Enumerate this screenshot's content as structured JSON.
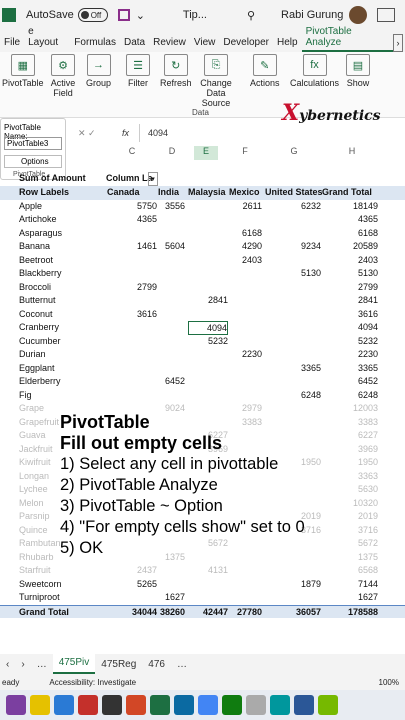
{
  "titlebar": {
    "autosave": "AutoSave",
    "toggle": "Off",
    "doc": "Tip...",
    "user": "Rabi Gurung"
  },
  "tabs": [
    "File",
    "e Layout",
    "Formulas",
    "Data",
    "Review",
    "View",
    "Developer",
    "Help",
    "PivotTable Analyze"
  ],
  "ribbon": {
    "pivottable": "PivotTable",
    "active_field": "Active Field",
    "group": "Group",
    "filter": "Filter",
    "refresh": "Refresh",
    "change_source": "Change Data Source",
    "actions": "Actions",
    "calculations": "Calculations",
    "show": "Show",
    "data_group": "Data"
  },
  "brand": "ybernetics",
  "pivot_panel": {
    "label": "PivotTable Name:",
    "name": "PivotTable3",
    "options": "Options",
    "caption": "PivotTable"
  },
  "formula_bar": {
    "value": "4094"
  },
  "columns": [
    "C",
    "D",
    "E",
    "F",
    "G",
    "H"
  ],
  "pivot": {
    "header1": [
      "Sum of Amount",
      "Column La"
    ],
    "header2": [
      "Row Labels",
      "Canada",
      "India",
      "Malaysia",
      "Mexico",
      "United States",
      "Grand Total"
    ],
    "rows": [
      [
        "Apple",
        "5750",
        "3556",
        "",
        "2611",
        "6232",
        "18149"
      ],
      [
        "Artichoke",
        "4365",
        "",
        "",
        "",
        "",
        "4365"
      ],
      [
        "Asparagus",
        "",
        "",
        "",
        "6168",
        "",
        "6168"
      ],
      [
        "Banana",
        "1461",
        "5604",
        "",
        "4290",
        "9234",
        "20589"
      ],
      [
        "Beetroot",
        "",
        "",
        "",
        "2403",
        "",
        "2403"
      ],
      [
        "Blackberry",
        "",
        "",
        "",
        "",
        "5130",
        "5130"
      ],
      [
        "Broccoli",
        "2799",
        "",
        "",
        "",
        "",
        "2799"
      ],
      [
        "Butternut",
        "",
        "",
        "2841",
        "",
        "",
        "2841"
      ],
      [
        "Coconut",
        "3616",
        "",
        "",
        "",
        "",
        "3616"
      ],
      [
        "Cranberry",
        "",
        "",
        "4094",
        "",
        "",
        "4094"
      ],
      [
        "Cucumber",
        "",
        "",
        "5232",
        "",
        "",
        "5232"
      ],
      [
        "Durian",
        "",
        "",
        "",
        "2230",
        "",
        "2230"
      ],
      [
        "Eggplant",
        "",
        "",
        "",
        "",
        "3365",
        "3365"
      ],
      [
        "Elderberry",
        "",
        "6452",
        "",
        "",
        "",
        "6452"
      ],
      [
        "Fig",
        "",
        "",
        "",
        "",
        "6248",
        "6248"
      ]
    ],
    "faded_rows": [
      [
        "Grape",
        "",
        "9024",
        "",
        "2979",
        "",
        "12003"
      ],
      [
        "Grapefruit",
        "",
        "",
        "",
        "3383",
        "",
        "3383"
      ],
      [
        "Guava",
        "",
        "",
        "6227",
        "",
        "",
        "6227"
      ],
      [
        "Jackfruit",
        "",
        "",
        "3969",
        "",
        "",
        "3969"
      ],
      [
        "Kiwifruit",
        "",
        "",
        "",
        "",
        "1950",
        "1950"
      ],
      [
        "Longan",
        "",
        "",
        "",
        "",
        "",
        "3363"
      ],
      [
        "Lychee",
        "",
        "",
        "",
        "",
        "",
        "5630"
      ],
      [
        "Melon",
        "",
        "",
        "",
        "",
        "",
        "10320"
      ],
      [
        "Parsnip",
        "",
        "",
        "",
        "",
        "2019",
        "2019"
      ],
      [
        "Quince",
        "",
        "",
        "",
        "",
        "3716",
        "3716"
      ],
      [
        "Rambutan",
        "",
        "",
        "5672",
        "",
        "",
        "5672"
      ],
      [
        "Rhubarb",
        "",
        "1375",
        "",
        "",
        "",
        "1375"
      ],
      [
        "Starfruit",
        "2437",
        "",
        "4131",
        "",
        "",
        "6568"
      ]
    ],
    "tail_rows": [
      [
        "Sweetcorn",
        "5265",
        "",
        "",
        "",
        "1879",
        "7144"
      ],
      [
        "Turniproot",
        "",
        "1627",
        "",
        "",
        "",
        "1627"
      ]
    ],
    "total": [
      "Grand Total",
      "34044",
      "38260",
      "42447",
      "27780",
      "36057",
      "178588"
    ]
  },
  "overlay": {
    "title1": "PivotTable",
    "title2": "Fill out empty cells",
    "steps": [
      "1) Select any cell in pivottable",
      "2) PivotTable Analyze",
      "3) PivotTable ~ Option",
      "4) \"For empty cells show\" set to 0",
      "5) OK"
    ]
  },
  "sheet_tabs": [
    "475Piv",
    "475Reg",
    "476"
  ],
  "status": {
    "left": "eady",
    "access": "Accessibility: Investigate",
    "zoom": "100%"
  }
}
